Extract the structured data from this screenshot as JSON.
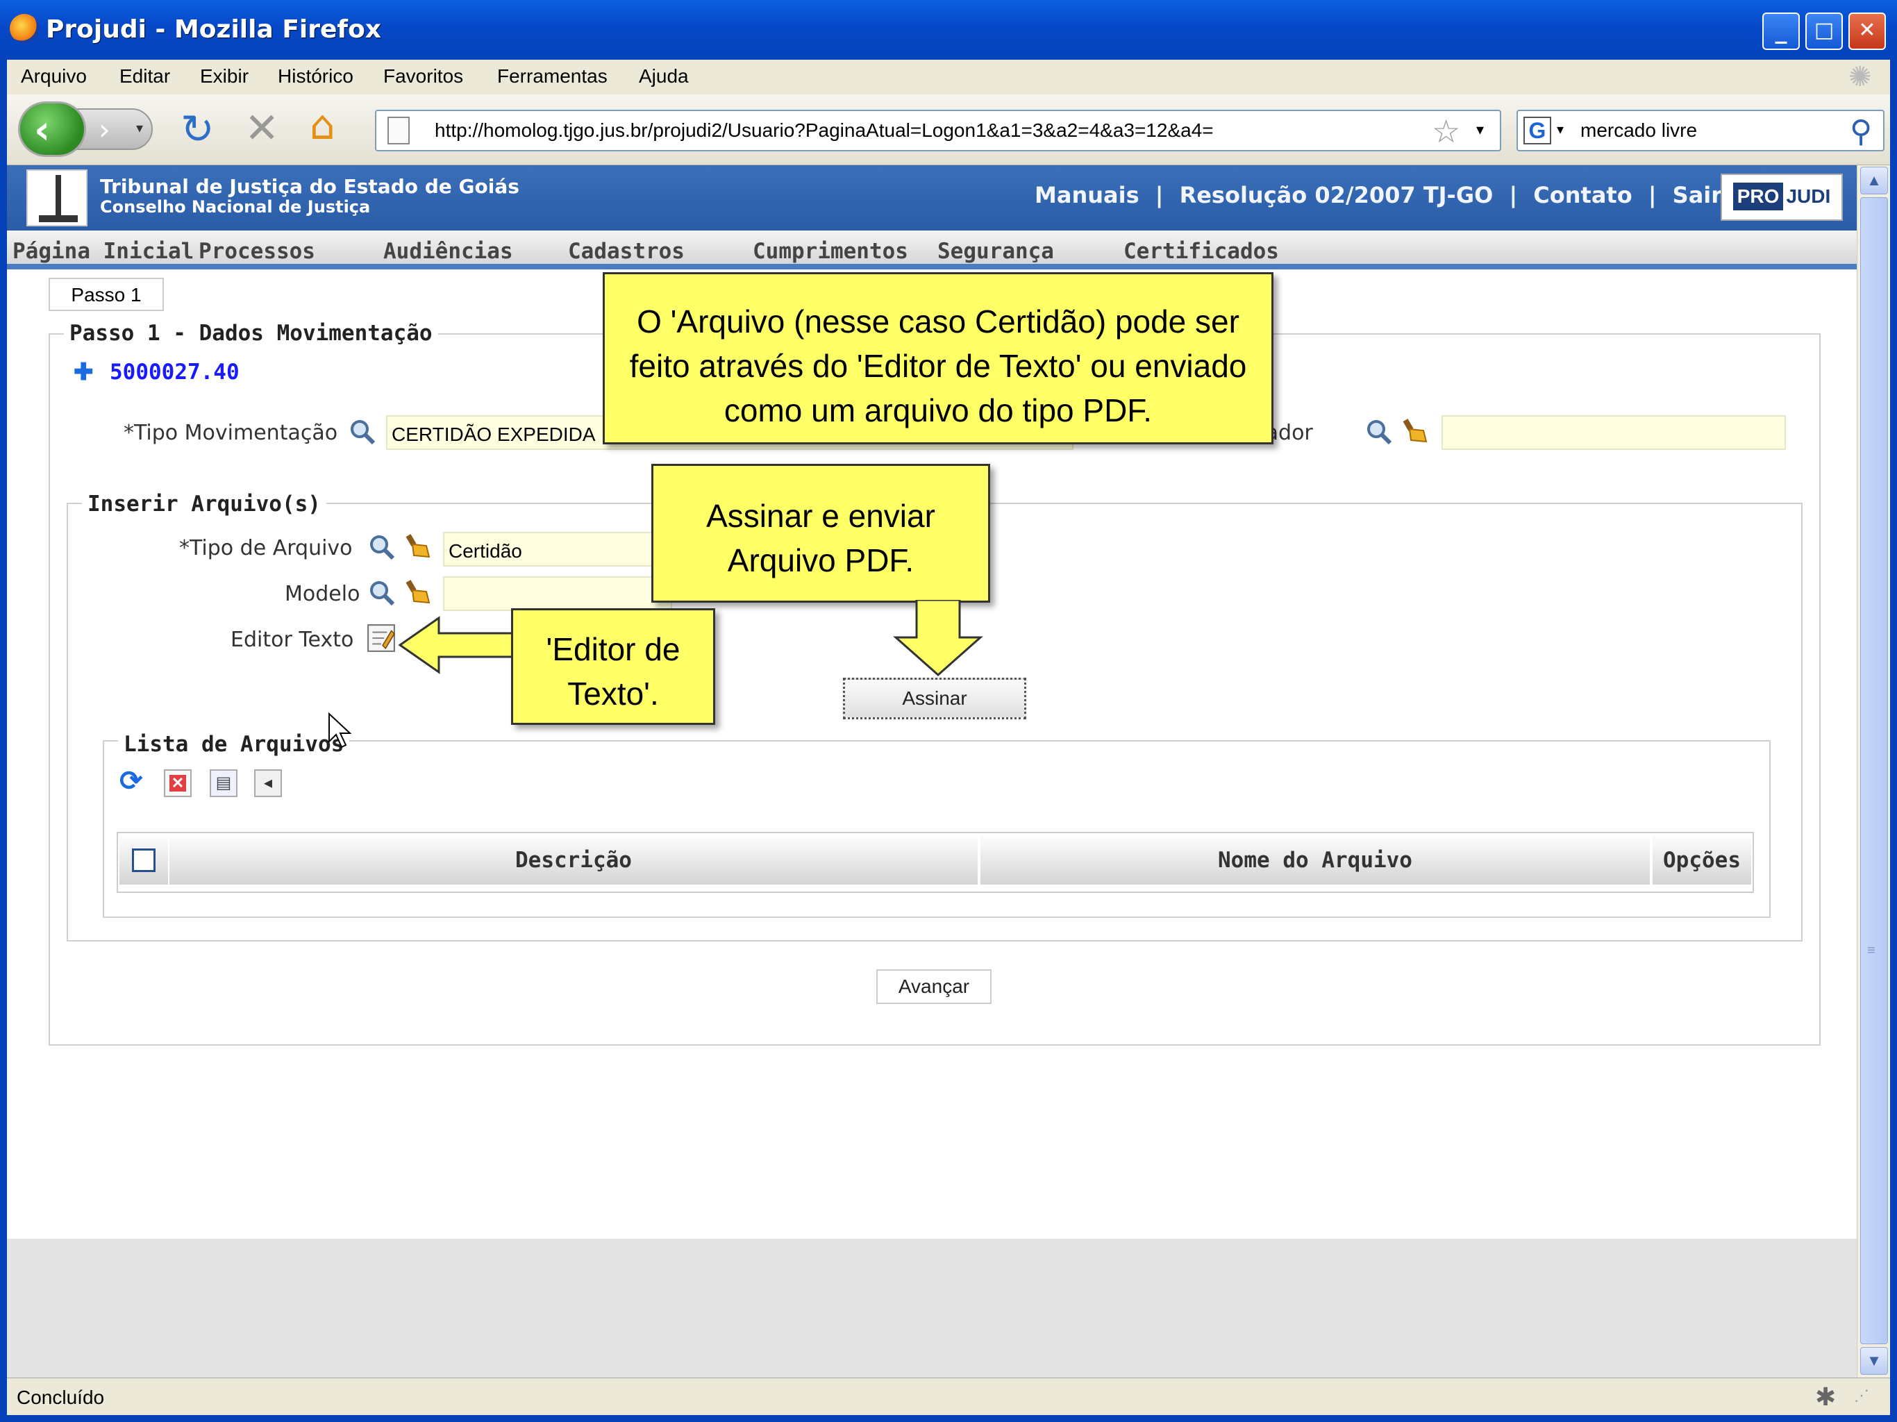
{
  "window": {
    "title": "Projudi - Mozilla Firefox",
    "minimize": "_",
    "maximize": "□",
    "close": "✕"
  },
  "menubar": [
    "Arquivo",
    "Editar",
    "Exibir",
    "Histórico",
    "Favoritos",
    "Ferramentas",
    "Ajuda"
  ],
  "navbar": {
    "url": "http://homolog.tjgo.jus.br/projudi2/Usuario?PaginaAtual=Logon1&a1=3&a2=4&a3=12&a4=",
    "search_value": "mercado livre",
    "search_engine_icon": "google-icon"
  },
  "header": {
    "org_line1": "Tribunal de Justiça do Estado de Goiás",
    "org_line2": "Conselho Nacional de Justiça",
    "links": [
      "Manuais",
      "Resolução 02/2007 TJ-GO",
      "Contato",
      "Sair"
    ],
    "separator": "|",
    "logo_pro": "PRO",
    "logo_judi": "JUDI"
  },
  "mainmenu": [
    "Página Inicial",
    "Processos",
    "Audiências",
    "Cadastros",
    "Cumprimentos",
    "Segurança",
    "Certificados"
  ],
  "form": {
    "tab": "Passo 1",
    "legend_main": "Passo 1 - Dados Movimentação",
    "process_number": "5000027.40",
    "tipo_mov_label": "*Tipo Movimentação",
    "tipo_mov_value": "CERTIDÃO EXPEDIDA",
    "classificador_label": "Classificador",
    "classificador_value": "",
    "legend_inserir": "Inserir Arquivo(s)",
    "tipo_arquivo_label": "*Tipo de Arquivo",
    "tipo_arquivo_value": "Certidão",
    "modelo_label": "Modelo",
    "modelo_value": "",
    "editor_label": "Editor Texto",
    "assinar_label": "Assinar",
    "legend_lista": "Lista de Arquivos",
    "table_headers": [
      "Descrição",
      "Nome do Arquivo",
      "Opções"
    ],
    "avancar_label": "Avançar"
  },
  "callouts": {
    "top": "O 'Arquivo (nesse caso Certidão) pode ser feito através do 'Editor de Texto' ou enviado como um arquivo do tipo PDF.",
    "assinar": "Assinar e enviar Arquivo PDF.",
    "editor": "'Editor de Texto'."
  },
  "status": {
    "text": "Concluído"
  },
  "colors": {
    "titlebar": "#0648c8",
    "banner": "#2a5ca8",
    "callout": "#ffff66",
    "field": "#ffffe0",
    "link_blue": "#1a1aff"
  }
}
